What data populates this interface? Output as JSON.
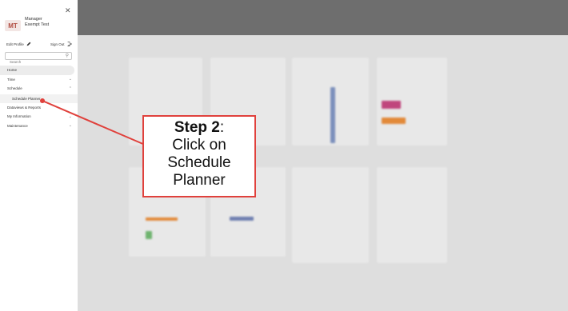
{
  "sidebar": {
    "avatar_initials": "MT",
    "user_name_line1": "Manager",
    "user_name_line2": "Exempt Test",
    "edit_profile": "Edit Profile",
    "sign_out": "Sign Out",
    "search_placeholder": "Search",
    "menu": {
      "home": "Home",
      "time": "Time",
      "schedule": "Schedule",
      "schedule_planner": "Schedule Planner",
      "datavisas_reports": "Dataviews & Reports",
      "my_information": "My Information",
      "maintenance": "Maintenance"
    }
  },
  "callout": {
    "step": "Step 2",
    "line1": "Click on",
    "line2": "Schedule",
    "line3": "Planner",
    "color": "#e0413c"
  }
}
